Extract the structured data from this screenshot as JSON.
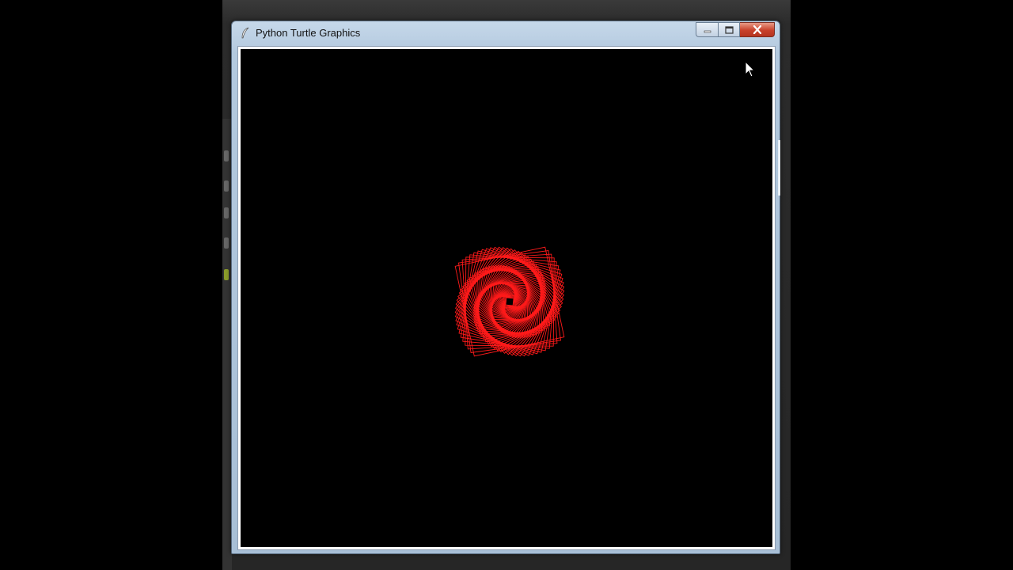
{
  "window": {
    "title": "Python Turtle Graphics",
    "icon": "feather-icon",
    "controls": {
      "minimize": "minimize-icon",
      "maximize": "maximize-icon",
      "close": "close-icon"
    }
  },
  "canvas": {
    "background": "#000000",
    "pen_color": "#ff1a1a",
    "drawing": "square-spiral"
  }
}
